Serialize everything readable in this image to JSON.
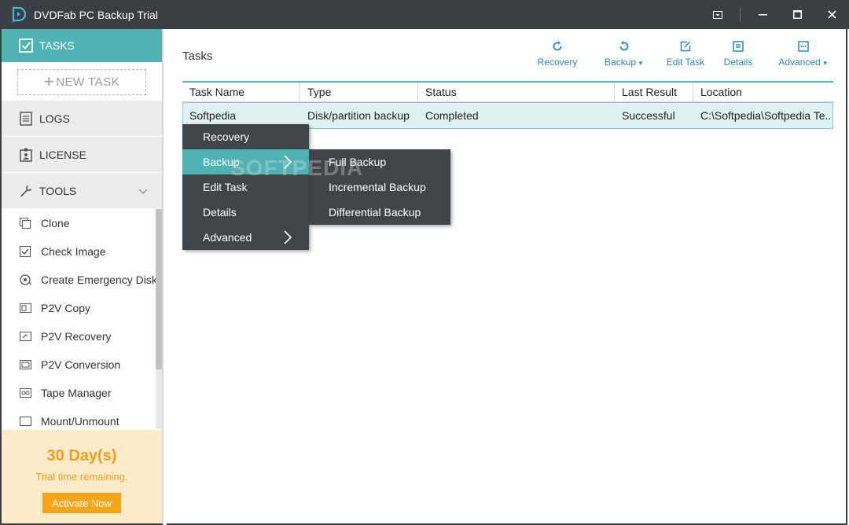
{
  "app": {
    "title": "DVDFab PC Backup Trial"
  },
  "sidebar": {
    "tasks_label": "TASKS",
    "new_task_label": "NEW TASK",
    "logs_label": "LOGS",
    "license_label": "LICENSE",
    "tools_label": "TOOLS",
    "tools": [
      {
        "label": "Clone",
        "icon": "clone-icon"
      },
      {
        "label": "Check Image",
        "icon": "check-image-icon"
      },
      {
        "label": "Create Emergency Disk",
        "icon": "emergency-disk-icon"
      },
      {
        "label": "P2V Copy",
        "icon": "p2v-copy-icon"
      },
      {
        "label": "P2V Recovery",
        "icon": "p2v-recovery-icon"
      },
      {
        "label": "P2V Conversion",
        "icon": "p2v-conversion-icon"
      },
      {
        "label": "Tape Manager",
        "icon": "tape-manager-icon"
      },
      {
        "label": "Mount/Unmount",
        "icon": "mount-icon"
      }
    ]
  },
  "trial": {
    "days": "30 Day(s)",
    "text": "Trial time remaining.",
    "activate_label": "Activate Now"
  },
  "main": {
    "title": "Tasks",
    "toolbar": {
      "recovery": "Recovery",
      "backup": "Backup",
      "edit_task": "Edit Task",
      "details": "Details",
      "advanced": "Advanced"
    },
    "table": {
      "columns": [
        "Task Name",
        "Type",
        "Status",
        "Last Result",
        "Location"
      ],
      "rows": [
        [
          "Softpedia",
          "Disk/partition backup",
          "Completed",
          "Successful",
          "C:\\Softpedia\\Softpedia Te..."
        ]
      ]
    }
  },
  "context_menu": {
    "items": [
      "Recovery",
      "Backup",
      "Edit Task",
      "Details",
      "Advanced"
    ],
    "highlighted": "Backup",
    "submenu": [
      "Full Backup",
      "Incremental Backup",
      "Differential Backup"
    ]
  },
  "watermark": "SOFTPEDIA",
  "colors": {
    "titlebar": "#3a3f44",
    "accent_teal": "#4fb3b3",
    "link_blue": "#2b89b4",
    "trial_orange": "#f0a01b",
    "menu_bg": "#3f4549"
  }
}
